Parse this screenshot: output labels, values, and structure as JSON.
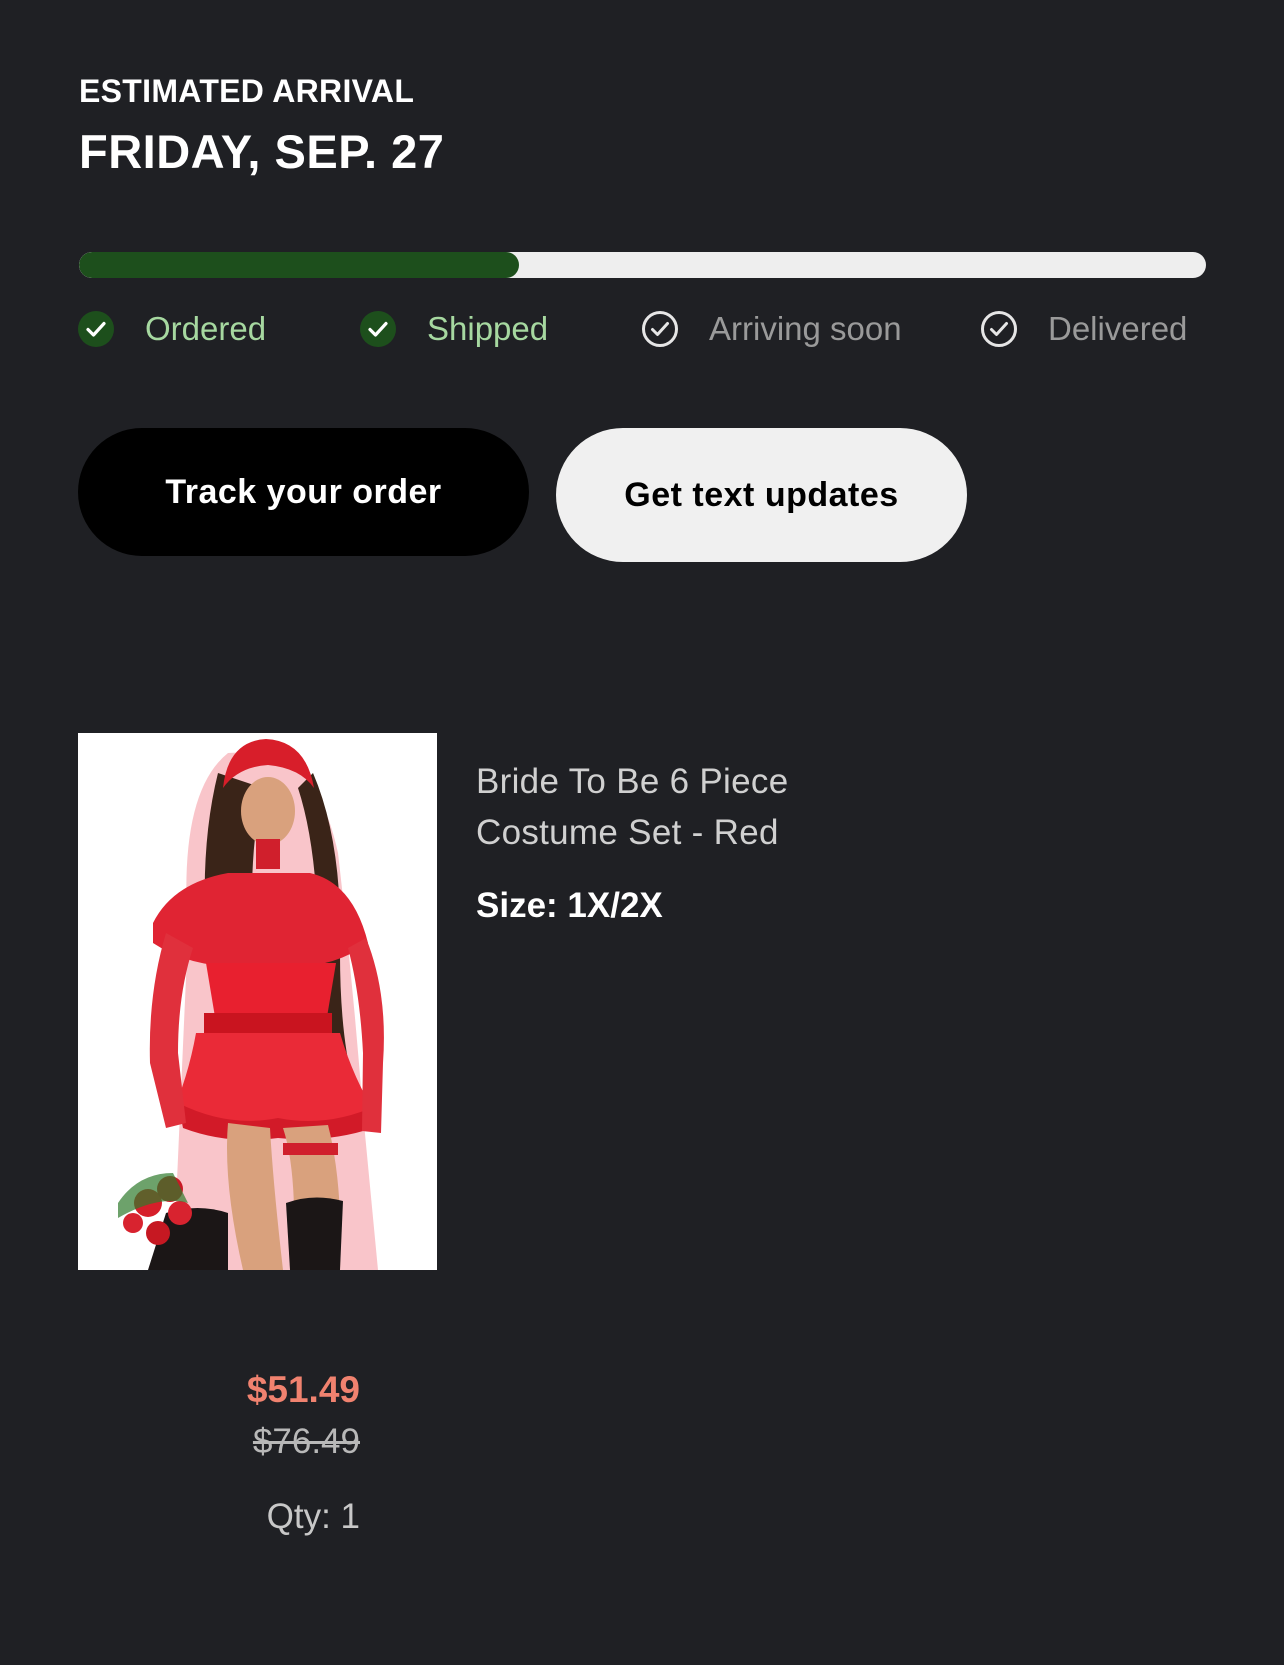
{
  "eta": {
    "label": "ESTIMATED ARRIVAL",
    "date": "FRIDAY, SEP. 27"
  },
  "progress": {
    "percent": 39,
    "steps": [
      {
        "label": "Ordered",
        "state": "done"
      },
      {
        "label": "Shipped",
        "state": "done"
      },
      {
        "label": "Arriving soon",
        "state": "pending"
      },
      {
        "label": "Delivered",
        "state": "pending"
      }
    ]
  },
  "actions": {
    "track_label": "Track your order",
    "text_updates_label": "Get text updates"
  },
  "product": {
    "name": "Bride To Be 6 Piece Costume Set - Red",
    "size": "Size: 1X/2X",
    "price": "$51.49",
    "original_price": "$76.49",
    "quantity": "Qty: 1"
  },
  "colors": {
    "background": "#1f2024",
    "progress_fill": "#1d4f1c",
    "progress_track": "#eeeeee",
    "done_text": "#a6d8a0",
    "pending_text": "#9a9a9a",
    "sale_price": "#f0826f"
  }
}
